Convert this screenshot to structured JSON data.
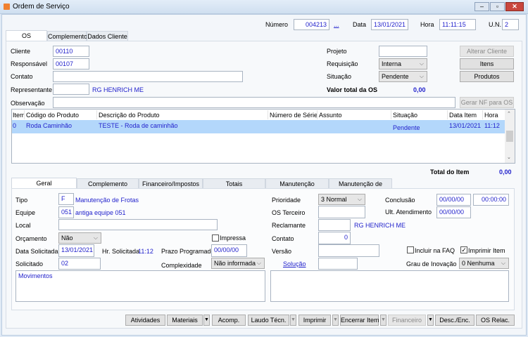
{
  "window": {
    "title": "Ordem de Serviço",
    "icon": "app-icon"
  },
  "header": {
    "numero_label": "Número",
    "numero": "004213",
    "lookup": "...",
    "data_label": "Data",
    "data": "13/01/2021",
    "hora_label": "Hora",
    "hora": "11:11:15",
    "un_label": "U.N.",
    "un": "2"
  },
  "tabs": [
    "OS",
    "Complemento",
    "Dados Cliente"
  ],
  "os": {
    "cliente_label": "Cliente",
    "cliente": "00110",
    "responsavel_label": "Responsável",
    "responsavel": "00107",
    "contato_label": "Contato",
    "contato": "",
    "representante_label": "Representante",
    "representante": "",
    "representante_nome": "RG HENRICH ME",
    "observacao_label": "Observação",
    "observacao": "",
    "projeto_label": "Projeto",
    "projeto": "",
    "requisicao_label": "Requisição",
    "requisicao": "Interna",
    "situacao_label": "Situação",
    "situacao": "Pendente",
    "valor_total_label": "Valor total da OS",
    "valor_total": "0,00",
    "buttons": {
      "alterar_cliente": "Alterar Cliente",
      "itens": "Itens",
      "produtos": "Produtos",
      "gerar_nf": "Gerar NF para OS"
    }
  },
  "grid": {
    "columns": [
      "Item",
      "Código do Produto",
      "Descrição do Produto",
      "Número de Série",
      "Assunto",
      "Situação",
      "Data Item",
      "Hora"
    ],
    "rows": [
      [
        "0",
        "Roda Caminhão",
        "TESTE - Roda de caminhão",
        "",
        "",
        "Pendente",
        "13/01/2021",
        "11:12"
      ]
    ]
  },
  "total_item": {
    "label": "Total do Item",
    "value": "0,00"
  },
  "subtabs": [
    "Geral",
    "Complemento",
    "Financeiro/Impostos",
    "Totais",
    "Manutenção Industrial",
    "Manutenção de Frotas"
  ],
  "geral": {
    "tipo_label": "Tipo",
    "tipo": "F",
    "tipo_desc": "Manutenção de Frotas",
    "equipe_label": "Equipe",
    "equipe": "051",
    "equipe_desc": "antiga equipe 051",
    "local_label": "Local",
    "local": "",
    "orcamento_label": "Orçamento",
    "orcamento": "Não",
    "impressa_label": "Impressa",
    "impressa": false,
    "data_sol_label": "Data Solicitada",
    "data_sol": "13/01/2021",
    "hr_sol_label": "Hr. Solicitada",
    "hr_sol": "11:12",
    "prazo_label": "Prazo Programado",
    "prazo": "00/00/00",
    "solicitado_label": "Solicitado",
    "solicitado": "02",
    "complexidade_label": "Complexidade",
    "complexidade": "Não informada",
    "prioridade_label": "Prioridade",
    "prioridade": "3 Normal",
    "os_terceiro_label": "OS Terceiro",
    "os_terceiro": "",
    "reclamante_label": "Reclamante",
    "reclamante": "",
    "reclamante_nome": "RG HENRICH ME",
    "contato_label": "Contato",
    "contato": "0",
    "versao_label": "Versão",
    "versao": "",
    "solucao_label": "Solução",
    "solucao": "",
    "conclusao_label": "Conclusão",
    "conclusao_data": "00/00/00",
    "conclusao_hora": "00:00:00",
    "ult_atend_label": "Ult. Atendimento",
    "ult_atend": "00/00/00",
    "faq_label": "Incluir na FAQ",
    "faq": false,
    "imprimir_item_label": "Imprimir Item",
    "imprimir_item": true,
    "grau_label": "Grau de Inovação",
    "grau": "0 Nenhuma",
    "movimentos": "Movimentos",
    "memo2": ""
  },
  "footer": {
    "atividades": "Atividades",
    "materiais": "Materiais",
    "acomp": "Acomp.",
    "laudo": "Laudo Técn.",
    "imprimir": "Imprimir",
    "encerrar": "Encerrar Item",
    "financeiro": "Financeiro",
    "desc_enc": "Desc./Enc.",
    "os_relac": "OS Relac."
  }
}
